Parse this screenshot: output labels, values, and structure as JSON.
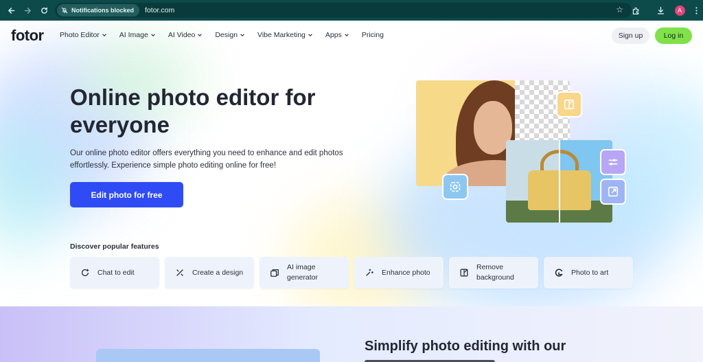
{
  "browser": {
    "notification_chip": "Notifications blocked",
    "url": "fotor.com",
    "profile_initial": "A"
  },
  "header": {
    "logo": "fotor",
    "nav": [
      {
        "label": "Photo Editor",
        "has_dropdown": true
      },
      {
        "label": "AI Image",
        "has_dropdown": true
      },
      {
        "label": "AI Video",
        "has_dropdown": true
      },
      {
        "label": "Design",
        "has_dropdown": true
      },
      {
        "label": "Vibe Marketing",
        "has_dropdown": true
      },
      {
        "label": "Apps",
        "has_dropdown": true
      },
      {
        "label": "Pricing",
        "has_dropdown": false
      }
    ],
    "signup_label": "Sign up",
    "login_label": "Log in"
  },
  "hero": {
    "title": "Online photo editor for everyone",
    "subtitle": "Our online photo editor offers everything you need to enhance and edit photos effortlessly. Experience simple photo editing online for free!",
    "cta_label": "Edit photo for free"
  },
  "features": {
    "title": "Discover popular features",
    "items": [
      {
        "label": "Chat to edit",
        "icon": "chat-edit-icon"
      },
      {
        "label": "Create a design",
        "icon": "design-tools-icon"
      },
      {
        "label": "AI image generator",
        "icon": "ai-image-icon"
      },
      {
        "label": "Enhance photo",
        "icon": "sparkle-enhance-icon"
      },
      {
        "label": "Remove background",
        "icon": "remove-bg-icon"
      },
      {
        "label": "Photo to art",
        "icon": "photo-to-art-icon"
      }
    ]
  },
  "lower": {
    "title": "Simplify photo editing with our"
  },
  "colors": {
    "chrome": "#0d4a4a",
    "cta": "#2f4bf5",
    "login": "#7fe24a",
    "feature_bg": "#eef3fb"
  }
}
